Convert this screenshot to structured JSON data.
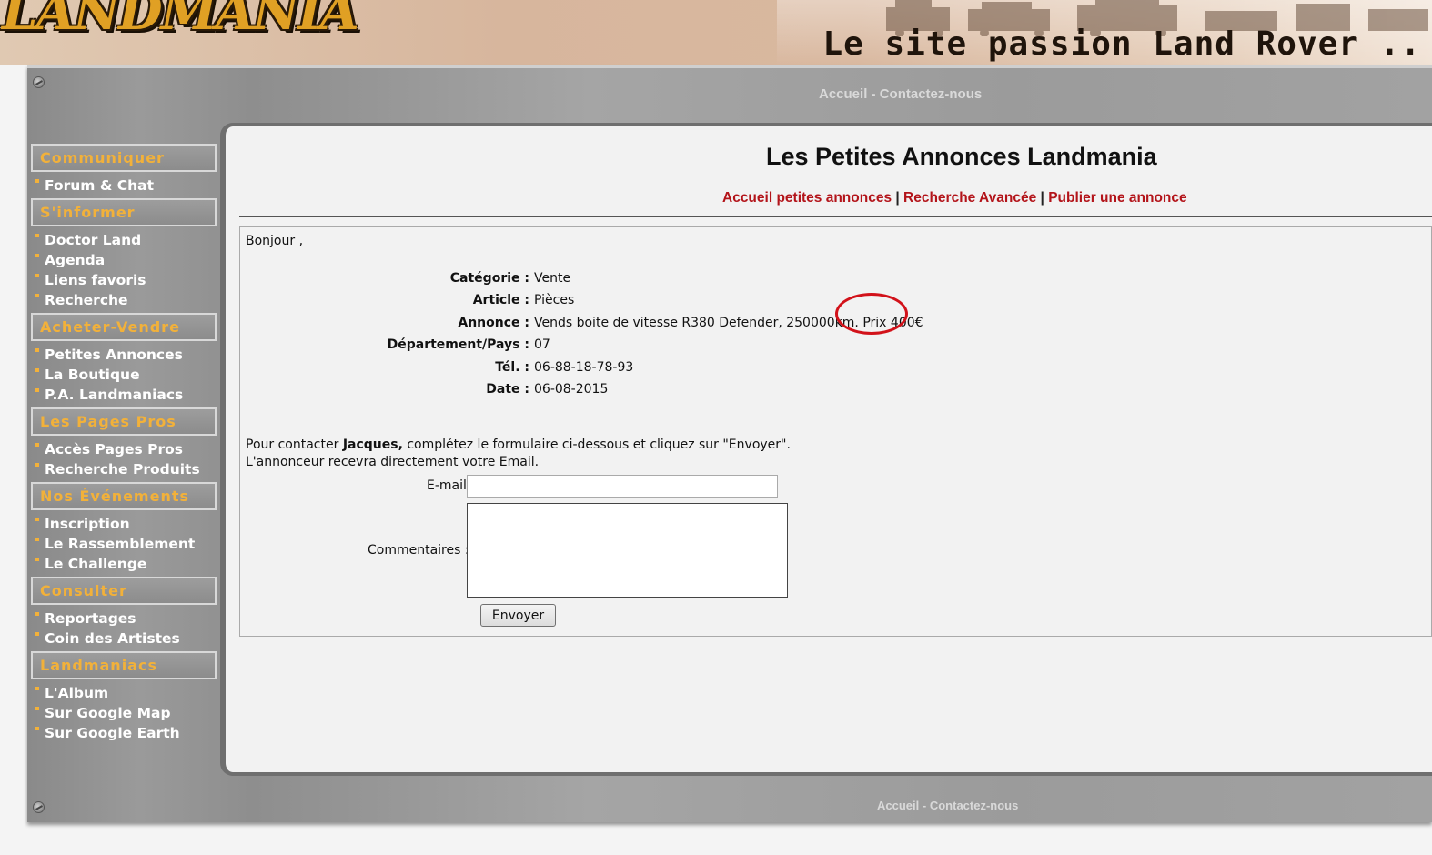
{
  "header": {
    "logo_text": "LANDMANIA",
    "slogan": "Le site passion Land Rover .."
  },
  "top_nav": {
    "home": "Accueil",
    "sep": "-",
    "contact": "Contactez-nous"
  },
  "bottom_nav": {
    "home": "Accueil",
    "sep": "-",
    "contact": "Contactez-nous"
  },
  "sidebar": {
    "sections": [
      {
        "title": "Communiquer",
        "items": [
          "Forum & Chat"
        ]
      },
      {
        "title": "S'informer",
        "items": [
          "Doctor Land",
          "Agenda",
          "Liens favoris",
          "Recherche"
        ]
      },
      {
        "title": "Acheter-Vendre",
        "items": [
          "Petites Annonces",
          "La Boutique",
          "P.A. Landmaniacs"
        ]
      },
      {
        "title": "Les Pages Pros",
        "items": [
          "Accès Pages Pros",
          "Recherche Produits"
        ]
      },
      {
        "title": "Nos Événements",
        "items": [
          "Inscription",
          "Le Rassemblement",
          "Le Challenge"
        ]
      },
      {
        "title": "Consulter",
        "items": [
          "Reportages",
          "Coin des Artistes"
        ]
      },
      {
        "title": "Landmaniacs",
        "items": [
          "L'Album",
          "Sur Google Map",
          "Sur Google Earth"
        ]
      }
    ]
  },
  "main": {
    "title": "Les Petites Annonces Landmania",
    "subnav": {
      "home": "Accueil petites annonces",
      "sep": "|",
      "search": "Recherche Avancée",
      "publish": "Publier une annonce"
    },
    "greeting": "Bonjour ,",
    "ad": {
      "rows": [
        {
          "label": "Catégorie :",
          "value": "Vente"
        },
        {
          "label": "Article :",
          "value": "Pièces"
        },
        {
          "label": "Annonce :",
          "value": "Vends boite de vitesse R380 Defender, 250000km. Prix 400€"
        },
        {
          "label": "Département/Pays :",
          "value": "07"
        },
        {
          "label": "Tél. :",
          "value": "06-88-18-78-93"
        },
        {
          "label": "Date :",
          "value": "06-08-2015"
        }
      ]
    },
    "contact": {
      "line1_prefix": "Pour contacter ",
      "seller": "Jacques,",
      "line1_suffix": " complétez le formulaire ci-dessous et cliquez sur \"Envoyer\".",
      "line2": "L'annonceur recevra directement votre Email.",
      "email_label": "E-mail",
      "email_value": "",
      "comment_label": "Commentaires :",
      "comment_value": "",
      "submit_label": "Envoyer"
    }
  },
  "colors": {
    "section_title": "#f2b13a",
    "link_red": "#b3141a",
    "highlight_circle": "#d2121a"
  }
}
